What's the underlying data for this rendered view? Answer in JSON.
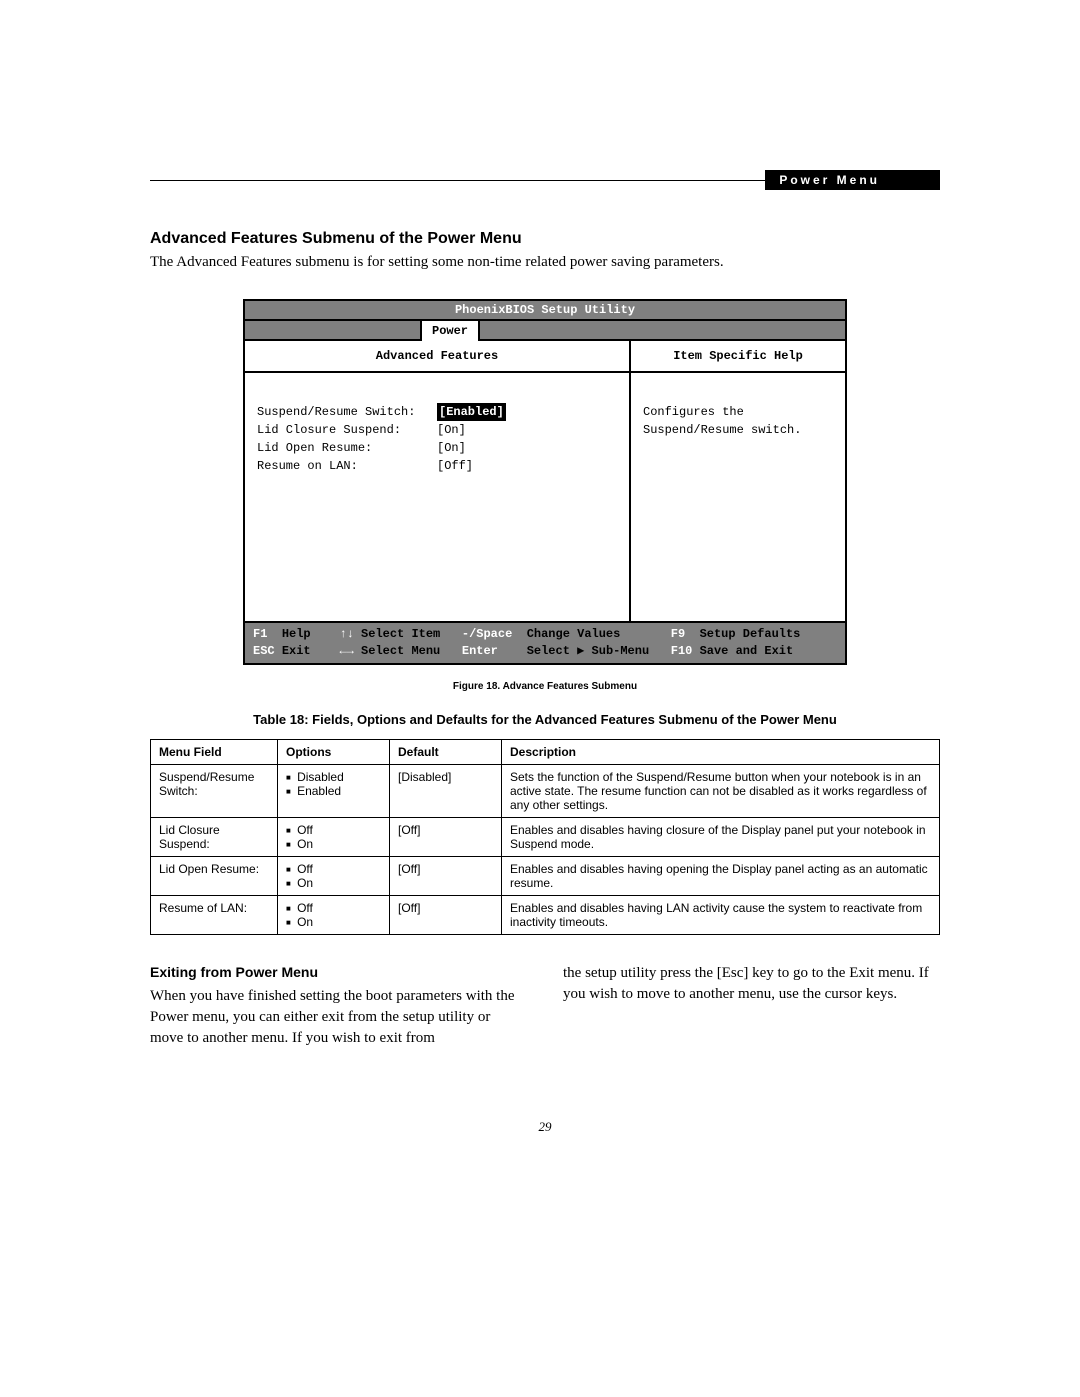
{
  "header": {
    "tag": "Power Menu"
  },
  "section": {
    "title": "Advanced Features Submenu of the Power Menu",
    "intro": "The Advanced Features submenu is for setting some non-time related power saving parameters."
  },
  "bios": {
    "title": "PhoenixBIOS Setup Utility",
    "tab": "Power",
    "left_heading": "Advanced Features",
    "right_heading": "Item Specific Help",
    "rows": [
      {
        "label": "Suspend/Resume Switch:",
        "value": "[Enabled]",
        "selected": true
      },
      {
        "label": "Lid Closure Suspend:",
        "value": "[On]",
        "selected": false
      },
      {
        "label": "Lid Open Resume:",
        "value": "[On]",
        "selected": false
      },
      {
        "label": "Resume on LAN:",
        "value": "[Off]",
        "selected": false
      }
    ],
    "help": "Configures the Suspend/Resume switch.",
    "footer": {
      "f1": "F1",
      "f1_lbl": "Help",
      "up": "↑↓",
      "up_lbl": "Select Item",
      "sp": "-/Space",
      "sp_lbl": "Change Values",
      "f9": "F9",
      "f9_lbl": "Setup Defaults",
      "esc": "ESC",
      "esc_lbl": "Exit",
      "lr": "←→",
      "lr_lbl": "Select Menu",
      "ent": "Enter",
      "ent_lbl": "Select ▶ Sub-Menu",
      "f10": "F10",
      "f10_lbl": "Save and Exit"
    }
  },
  "figure_caption": "Figure 18.   Advance Features Submenu",
  "table_title": "Table 18: Fields, Options and Defaults for the Advanced Features Submenu of the Power Menu",
  "table": {
    "headers": {
      "menu": "Menu Field",
      "options": "Options",
      "default": "Default",
      "desc": "Description"
    },
    "rows": [
      {
        "menu": "Suspend/Resume Switch:",
        "opts": [
          "Disabled",
          "Enabled"
        ],
        "default": "[Disabled]",
        "desc": "Sets the function of the Suspend/Resume button when your notebook is in an active state. The resume function can not be disabled as it works regardless of any other settings."
      },
      {
        "menu": "Lid Closure Suspend:",
        "opts": [
          "Off",
          "On"
        ],
        "default": "[Off]",
        "desc": "Enables and disables having closure of the Display panel put your notebook in Suspend mode."
      },
      {
        "menu": "Lid Open Resume:",
        "opts": [
          "Off",
          "On"
        ],
        "default": "[Off]",
        "desc": "Enables and disables having opening the Display panel acting as an automatic resume."
      },
      {
        "menu": "Resume of LAN:",
        "opts": [
          "Off",
          "On"
        ],
        "default": "[Off]",
        "desc": "Enables and disables having LAN activity cause the system to reactivate from inactivity timeouts."
      }
    ]
  },
  "exit": {
    "heading": "Exiting from Power Menu",
    "col1": "When you have finished setting the boot parameters with the Power menu, you can either exit from the setup utility or move to another menu. If you wish to exit from",
    "col2": "the setup utility press the [Esc] key to go to the Exit menu. If you wish to move to another menu, use the cursor keys."
  },
  "page_number": "29"
}
